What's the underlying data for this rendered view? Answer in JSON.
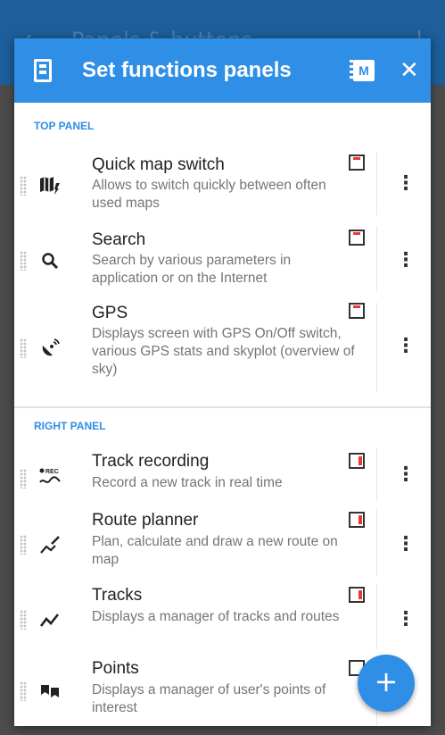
{
  "background": {
    "title": "Panels & buttons"
  },
  "dialog": {
    "title": "Set functions panels",
    "m_label": "M",
    "close_label": "✕"
  },
  "sections": {
    "top": "TOP PANEL",
    "right": "RIGHT PANEL"
  },
  "top_items": [
    {
      "title": "Quick map switch",
      "desc": "Allows to switch quickly between often used maps"
    },
    {
      "title": "Search",
      "desc": "Search by various parameters in application or on the Internet"
    },
    {
      "title": "GPS",
      "desc": "Displays screen with GPS On/Off switch, various GPS stats and skyplot (overview of sky)"
    }
  ],
  "right_items": [
    {
      "title": "Track recording",
      "desc": "Record a new track in real time"
    },
    {
      "title": "Route planner",
      "desc": "Plan, calculate and draw a new route on map"
    },
    {
      "title": "Tracks",
      "desc": "Displays a manager of tracks and routes"
    },
    {
      "title": "Points",
      "desc": "Displays a manager of user's points of interest"
    }
  ],
  "more_label": "⋮",
  "fab_label": "+",
  "colors": {
    "accent": "#2f8ee5",
    "panel_marker": "#e53935"
  }
}
